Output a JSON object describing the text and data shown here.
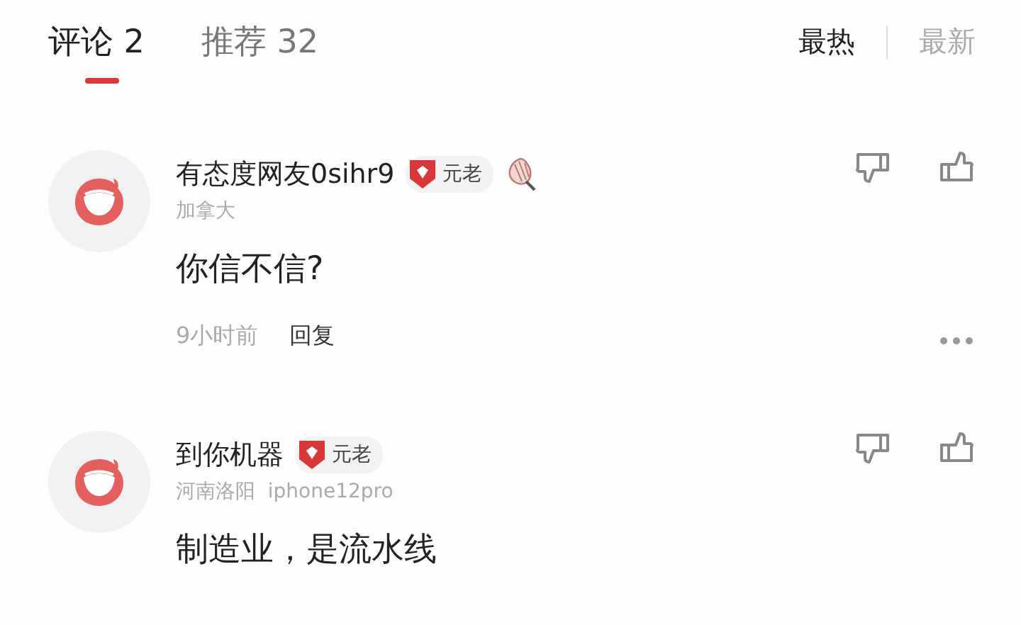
{
  "tabs": [
    {
      "label": "评论 2",
      "selected": true
    },
    {
      "label": "推荐 32",
      "selected": false
    }
  ],
  "sort": [
    {
      "label": "最热",
      "selected": true
    },
    {
      "label": "最新",
      "selected": false
    }
  ],
  "comments": [
    {
      "author": "有态度网友0sihr9",
      "badges": [
        {
          "kind": "rank",
          "label": "元老"
        },
        {
          "kind": "medal"
        }
      ],
      "location": "加拿大",
      "text": "你信不信?",
      "time": "9小时前",
      "reply": "回复",
      "more_button": true
    },
    {
      "author": "到你机器",
      "badges": [
        {
          "kind": "rank",
          "label": "元老"
        }
      ],
      "location": "河南洛阳  iphone12pro",
      "text": "制造业，是流水线"
    }
  ]
}
